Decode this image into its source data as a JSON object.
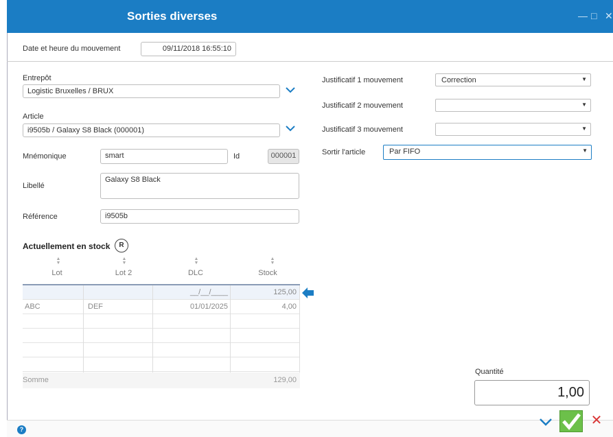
{
  "window": {
    "title": "Sorties diverses",
    "controls": [
      "—",
      "□",
      "✕"
    ]
  },
  "movement": {
    "label": "Date et heure du mouvement",
    "datetime": "09/11/2018 16:55:10"
  },
  "form": {
    "entrepot_label": "Entrepôt",
    "entrepot_value": "Logistic Bruxelles / BRUX",
    "article_label": "Article",
    "article_value": "i9505b / Galaxy S8 Black (000001)",
    "mnemonique_label": "Mnémonique",
    "mnemonique_value": "smart",
    "id_label": "Id",
    "id_value": "000001",
    "libelle_label": "Libellé",
    "libelle_value": "Galaxy S8 Black",
    "reference_label": "Référence",
    "reference_value": "i9505b"
  },
  "justificatifs": {
    "j1_label": "Justificatif 1 mouvement",
    "j1_value": "Correction",
    "j2_label": "Justificatif 2 mouvement",
    "j2_value": "",
    "j3_label": "Justificatif 3 mouvement",
    "j3_value": "",
    "sortir_label": "Sortir l'article",
    "sortir_value": "Par FIFO"
  },
  "stock": {
    "title": "Actuellement en stock",
    "badge": "R",
    "columns": [
      "Lot",
      "Lot 2",
      "DLC",
      "Stock"
    ],
    "rows": [
      {
        "lot": "",
        "lot2": "",
        "dlc": "__/__/____",
        "stock": "125,00"
      },
      {
        "lot": "ABC",
        "lot2": "DEF",
        "dlc": "01/01/2025",
        "stock": "4,00"
      }
    ],
    "sum_label": "Somme",
    "sum_value": "129,00"
  },
  "quantite": {
    "label": "Quantité",
    "value": "1,00"
  },
  "footer": {
    "help": "?"
  },
  "colors": {
    "accent": "#1b7dc4",
    "confirm": "#6cc04a",
    "cancel": "#d93636"
  }
}
